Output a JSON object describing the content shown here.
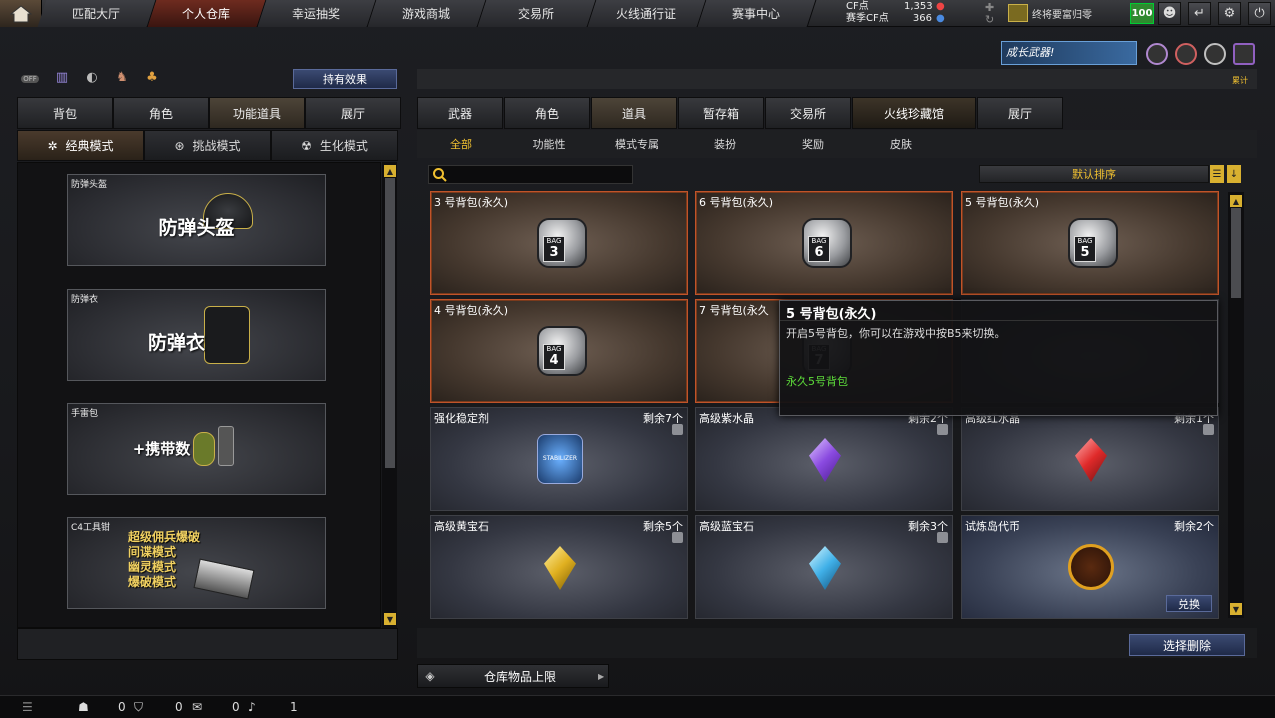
{
  "nav": {
    "tabs": [
      "匹配大厅",
      "个人仓库",
      "幸运抽奖",
      "游戏商城",
      "交易所",
      "火线通行证",
      "赛事中心"
    ],
    "active_index": 1
  },
  "currency": {
    "cf_label": "CF点",
    "cf_value": "1,353",
    "match_cf_label": "赛季CF点",
    "match_cf_value": "366"
  },
  "rank": {
    "title": "终将要富归零"
  },
  "level": "100",
  "growth_banner": "成长武器!",
  "right_small_label": "累计",
  "left": {
    "icon_off_label": "OFF",
    "effect_button": "持有效果",
    "tabs": [
      "背包",
      "角色",
      "功能道具",
      "展厅"
    ],
    "active_tab": 2,
    "modes": [
      "经典模式",
      "挑战模式",
      "生化模式"
    ],
    "active_mode": 0,
    "cards": [
      {
        "title": "防弹头盔",
        "big": "防弹头盔"
      },
      {
        "title": "防弹衣",
        "big": "防弹衣"
      },
      {
        "title": "手雷包",
        "big": "+携带数"
      },
      {
        "title": "C4工具钳",
        "lines": [
          "超级佣兵爆破",
          "间谍模式",
          "幽灵模式",
          "爆破模式"
        ]
      }
    ]
  },
  "right": {
    "tabs": [
      "武器",
      "角色",
      "道具",
      "暂存箱",
      "交易所",
      "火线珍藏馆",
      "展厅"
    ],
    "active_tab": 2,
    "subtabs": [
      "全部",
      "功能性",
      "模式专属",
      "装扮",
      "奖励",
      "皮肤"
    ],
    "active_subtab": 0,
    "search_placeholder": "",
    "sort_label": "默认排序",
    "items": [
      {
        "name": "3 号背包(永久)",
        "bag": "3"
      },
      {
        "name": "6 号背包(永久)",
        "bag": "6"
      },
      {
        "name": "5 号背包(永久)",
        "bag": "5"
      },
      {
        "name": "4 号背包(永久)",
        "bag": "4"
      },
      {
        "name": "7 号背包(永久",
        "bag": "7"
      },
      {
        "name": ""
      },
      {
        "name": "强化稳定剂",
        "remain": "剩余7个"
      },
      {
        "name": "高级紫水晶",
        "remain": "剩余2个"
      },
      {
        "name": "高级红水晶",
        "remain": "剩余1个"
      },
      {
        "name": "高级黄宝石",
        "remain": "剩余5个"
      },
      {
        "name": "高级蓝宝石",
        "remain": "剩余3个"
      },
      {
        "name": "试炼岛代币",
        "remain": "剩余2个",
        "action": "兑换"
      }
    ],
    "bag_label": "BAG",
    "stabilizer_label": "STABILIZER",
    "delete_button": "选择删除",
    "limit_label": "仓库物品上限"
  },
  "tooltip": {
    "title": "5 号背包(永久)",
    "desc": "开启5号背包，你可以在游戏中按B5来切换。",
    "green": "永久5号背包"
  },
  "status": {
    "count1": "0",
    "count2": "0",
    "count3": "0",
    "count4": "1"
  },
  "colors": {
    "accent": "#f0c030",
    "bag_border": "#c0542a",
    "green": "#5ddc3a"
  }
}
